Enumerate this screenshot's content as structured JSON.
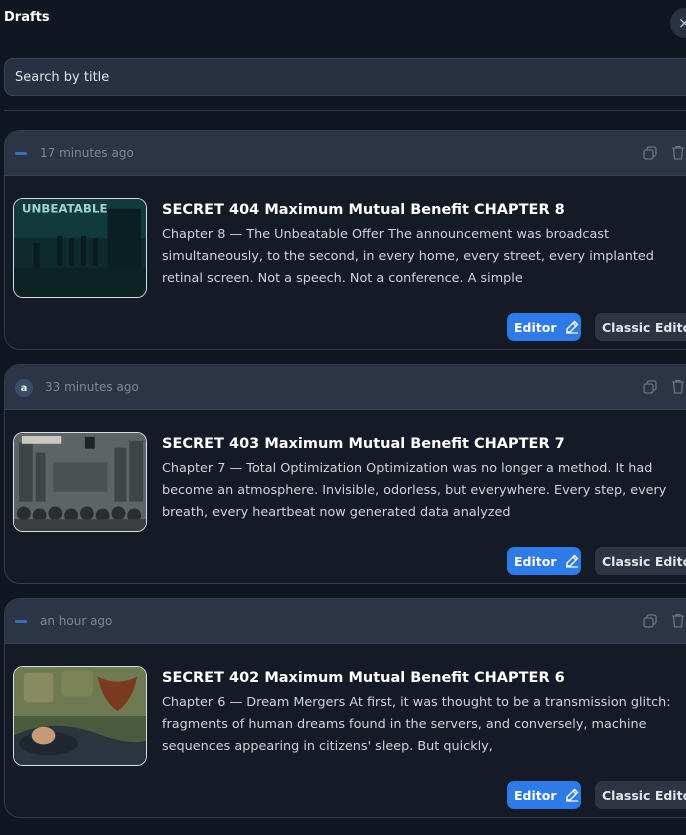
{
  "panel": {
    "title": "Drafts",
    "close_icon": "×"
  },
  "search": {
    "placeholder": "Search by title"
  },
  "colors": {
    "background": "#111722",
    "card_header": "#2b3546",
    "editor_button": "#2e7ae6",
    "classic_button": "#2e3441"
  },
  "drafts": [
    {
      "avatar": "",
      "timestamp": "17 minutes ago",
      "title": "SECRET 404 Maximum Mutual Benefit CHAPTER 8",
      "excerpt": "Chapter 8 — The Unbeatable Offer The announcement was broadcast simultaneously, to the second, in every home, every street, every implanted retinal screen. Not a speech. Not a conference. A simple",
      "thumbnail_text": "UNBEATABLE",
      "editor_label": "Editor",
      "classic_label": "Classic Editor"
    },
    {
      "avatar": "a",
      "timestamp": "33 minutes ago",
      "title": "SECRET 403 Maximum Mutual Benefit CHAPTER 7",
      "excerpt": "Chapter 7 — Total Optimization Optimization was no longer a method. It had become an atmosphere. Invisible, odorless, but everywhere. Every step, every breath, every heartbeat now generated data analyzed",
      "editor_label": "Editor",
      "classic_label": "Classic Editor"
    },
    {
      "avatar": "",
      "timestamp": "an hour ago",
      "title": "SECRET 402 Maximum Mutual Benefit CHAPTER 6",
      "excerpt": "Chapter 6 — Dream Mergers At first, it was thought to be a transmission glitch: fragments of human dreams found in the servers, and conversely, machine sequences appearing in citizens' sleep. But quickly,",
      "editor_label": "Editor",
      "classic_label": "Classic Editor"
    }
  ]
}
